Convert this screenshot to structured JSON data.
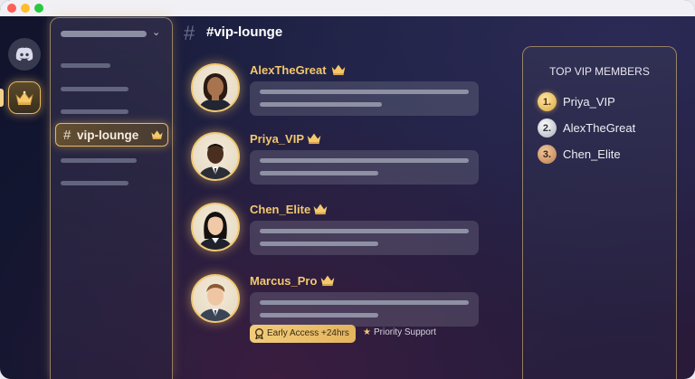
{
  "window": {
    "controls": [
      "close",
      "minimize",
      "zoom"
    ]
  },
  "server_rail": {
    "servers": [
      {
        "name": "Discord Home",
        "icon": "discord-logo-icon"
      },
      {
        "name": "VIP",
        "icon": "crown-icon",
        "active": true
      }
    ]
  },
  "channels": {
    "active_channel": {
      "hash": "#",
      "label": "vip-lounge",
      "icon": "crown-icon"
    }
  },
  "chat": {
    "hash": "#",
    "title": "#vip-lounge",
    "messages": [
      {
        "username": "AlexTheGreat",
        "badge_icon": "crown-icon",
        "avatar": "woman-avatar"
      },
      {
        "username": "Priya_VIP",
        "badge_icon": "crown-icon",
        "avatar": "man-suit-avatar"
      },
      {
        "username": "Chen_Elite",
        "badge_icon": "crown-icon",
        "avatar": "woman-avatar"
      },
      {
        "username": "Marcus_Pro",
        "badge_icon": "crown-icon",
        "avatar": "man-suit-avatar"
      }
    ],
    "perks": {
      "early_access": "Early Access +24hrs",
      "priority_support": "Priority Support"
    }
  },
  "top_vip": {
    "title": "TOP VIP MEMBERS",
    "ranks": [
      {
        "rank": "1.",
        "name": "Priya_VIP",
        "medal": "gold"
      },
      {
        "rank": "2.",
        "name": "AlexTheGreat",
        "medal": "silver"
      },
      {
        "rank": "3.",
        "name": "Chen_Elite",
        "medal": "bronze"
      }
    ]
  },
  "colors": {
    "accent_gold": "#f3c86e",
    "background": "#1c1f3f"
  }
}
